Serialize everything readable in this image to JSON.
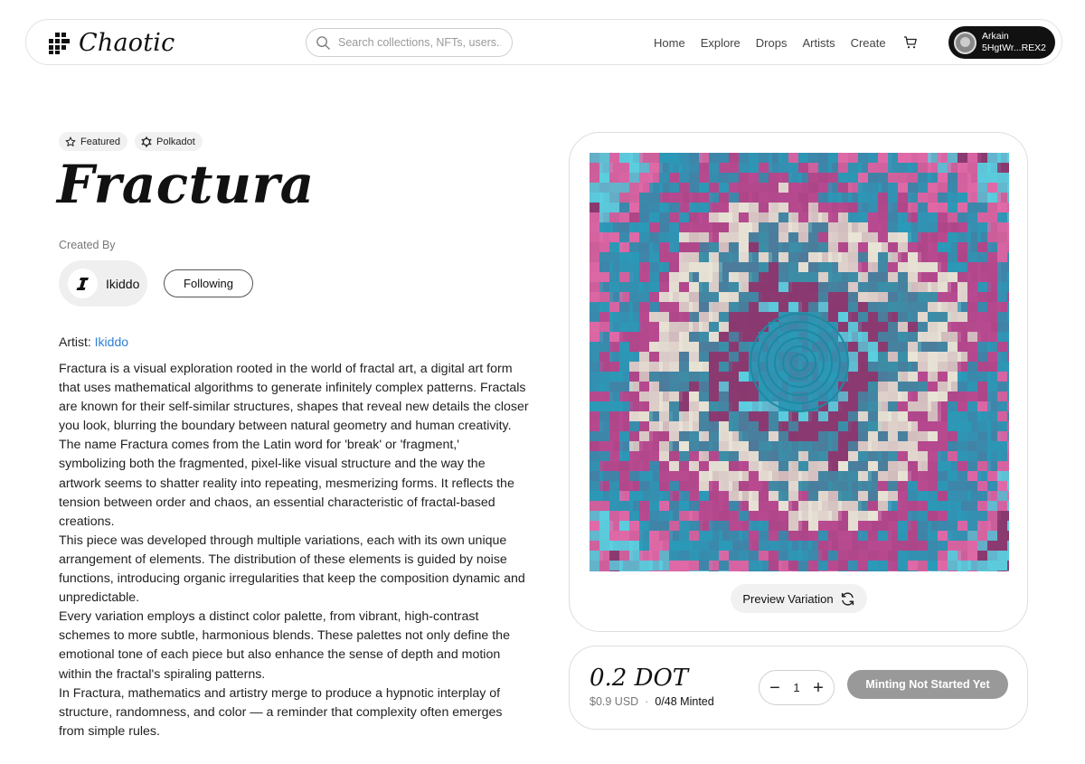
{
  "header": {
    "logo_text": "Chaotic",
    "search_placeholder": "Search collections, NFTs, users...",
    "nav": [
      "Home",
      "Explore",
      "Drops",
      "Artists",
      "Create"
    ],
    "account": {
      "name": "Arkain",
      "address": "5HgtWr...REX2"
    }
  },
  "badges": [
    {
      "label": "Featured",
      "icon": "star-icon"
    },
    {
      "label": "Polkadot",
      "icon": "polkadot-icon"
    }
  ],
  "title": "Fractura",
  "created_by_label": "Created By",
  "creator": {
    "name": "Ikiddo",
    "avatar_letter": "I"
  },
  "follow_label": "Following",
  "artist_label": "Artist:",
  "artist_name": "Ikiddo",
  "description": [
    "Fractura is a visual exploration rooted in the world of fractal art, a digital art form that uses mathematical algorithms to generate infinitely complex patterns. Fractals are known for their self-similar structures, shapes that reveal new details the closer you look, blurring the boundary between natural geometry and human creativity.",
    "The name Fractura comes from the Latin word for 'break' or 'fragment,' symbolizing both the fragmented, pixel-like visual structure and the way the artwork seems to shatter reality into repeating, mesmerizing forms. It reflects the tension between order and chaos, an essential characteristic of fractal-based creations.",
    "This piece was developed through multiple variations, each with its own unique arrangement of elements. The distribution of these elements is guided by noise functions, introducing organic irregularities that keep the composition dynamic and unpredictable.",
    "Every variation employs a distinct color palette, from vibrant, high-contrast schemes to more subtle, harmonious blends. These palettes not only define the emotional tone of each piece but also enhance the sense of depth and motion within the fractal's spiraling patterns.",
    "In Fractura, mathematics and artistry merge to produce a hypnotic interplay of structure, randomness, and color — a reminder that complexity often emerges from simple rules."
  ],
  "preview_label": "Preview Variation",
  "mint": {
    "price": "0.2 DOT",
    "usd": "$0.9 USD",
    "separator": "·",
    "minted": "0/48 Minted",
    "quantity": "1",
    "button_label": "Minting Not Started Yet"
  },
  "colors": {
    "accent_link": "#2f7fd6",
    "mint_button": "#999999",
    "art_palette": [
      "#e06aa8",
      "#5ad0e0",
      "#8a3a70",
      "#3a8fa8",
      "#e8e4d6",
      "#b84a90",
      "#2a9ab8"
    ]
  }
}
